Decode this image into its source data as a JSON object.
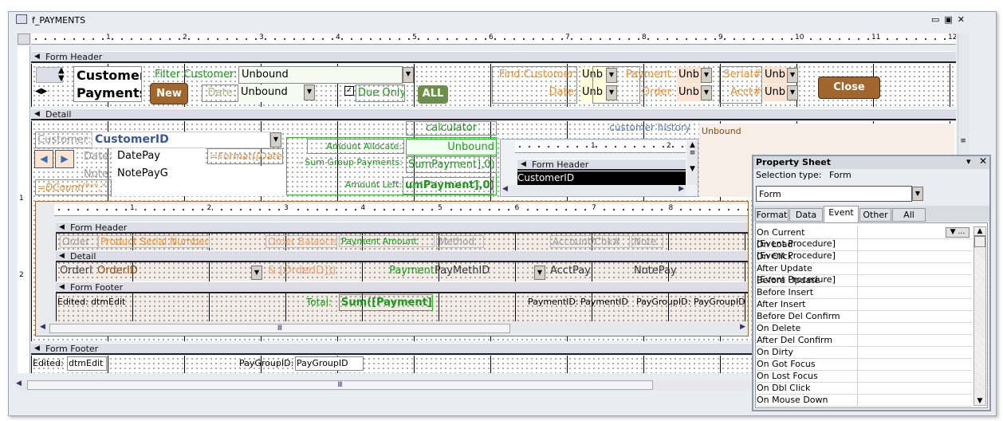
{
  "window": {
    "title": "f_PAYMENTS",
    "controls": [
      "minimize",
      "restore",
      "close"
    ]
  },
  "ruler": [
    "1",
    "2",
    "3",
    "4",
    "5",
    "6",
    "7",
    "8",
    "9",
    "10",
    "11",
    "12"
  ],
  "sections": {
    "form_header": "Form Header",
    "detail": "Detail",
    "form_footer": "Form Footer"
  },
  "header": {
    "title_line1": "Customer",
    "title_line2": "Payments",
    "filter_customer_label": "Filter Customer:",
    "filter_customer_value": "Unbound",
    "new_button": "New",
    "date_label": "Date:",
    "date_value": "Unbound",
    "due_only": "Due Only",
    "due_only_checked": true,
    "all_button": "ALL",
    "find_customer_label": "Find Customer:",
    "find_customer_value": "Unb",
    "date2_label": "Date:",
    "date2_value": "Unb",
    "payment_label": "Payment:",
    "payment_value": "Unb",
    "order_label": "Order:",
    "order_value": "Unb",
    "serial_label": "Serial#",
    "serial_value": "Unb",
    "acct_label": "Acct#",
    "acct_value": "Unb",
    "close_button": "Close"
  },
  "detail": {
    "customer_label": "Customer:",
    "customer_value": "CustomerID",
    "date_label": "Date:",
    "date_value": "DatePay",
    "format_expr": "=Format([Date",
    "note_label": "Note:",
    "note_value": "NotePayG",
    "dcount_expr": "=DCount(\"*\",\"",
    "calculator": "calculator",
    "amount_allocate_label": "Amount Allocate:",
    "amount_allocate_value": "Unbound",
    "sum_group_label": "- Sum Group Payments:",
    "sum_group_value": "SumPayment],0))",
    "amount_left_label": "Amount Left:",
    "amount_left_value": "umPayment],0))",
    "customer_history": "customer history",
    "history_value": "Unbound",
    "mini": {
      "ruler": [
        "1",
        "2"
      ],
      "header": "Form Header",
      "field": "CustomerID"
    }
  },
  "subform": {
    "ruler": [
      "1",
      "2",
      "3",
      "4",
      "5",
      "6",
      "7",
      "8"
    ],
    "header_cols": [
      "Order",
      "Product Serial Number",
      "Order Balance",
      "Payment Amount",
      "Method",
      "Account/Chk#",
      "Note"
    ],
    "detail_cols": [
      "OrderI",
      "OrderID",
      "& [OrderID]))",
      "Payment",
      "PayMethID",
      "AcctPay",
      "NotePay"
    ],
    "footer": {
      "edited_label": "Edited:",
      "edited_value": "dtmEdit",
      "total_label": "Total:",
      "total_value": "Sum([Payment])",
      "pid_label": "PaymentID:",
      "pid_value": "PaymentID",
      "pgid_label": "PayGroupID:",
      "pgid_value": "PayGroupID"
    }
  },
  "footer": {
    "edited_label": "Edited:",
    "edited_value": "dtmEdit",
    "pgid_label": "PayGroupID:",
    "pgid_value": "PayGroupID"
  },
  "property_sheet": {
    "title": "Property Sheet",
    "selection_type_label": "Selection type:",
    "selection_type": "Form",
    "object": "Form",
    "tabs": [
      "Format",
      "Data",
      "Event",
      "Other",
      "All"
    ],
    "active_tab": "Event",
    "rows": [
      {
        "name": "On Current",
        "value": "[Event Procedure]"
      },
      {
        "name": "On Load",
        "value": "[Event Procedure]"
      },
      {
        "name": "On Click",
        "value": ""
      },
      {
        "name": "After Update",
        "value": "[Event Procedure]"
      },
      {
        "name": "Before Update",
        "value": ""
      },
      {
        "name": "Before Insert",
        "value": ""
      },
      {
        "name": "After Insert",
        "value": ""
      },
      {
        "name": "Before Del Confirm",
        "value": ""
      },
      {
        "name": "On Delete",
        "value": ""
      },
      {
        "name": "After Del Confirm",
        "value": ""
      },
      {
        "name": "On Dirty",
        "value": ""
      },
      {
        "name": "On Got Focus",
        "value": ""
      },
      {
        "name": "On Lost Focus",
        "value": ""
      },
      {
        "name": "On Dbl Click",
        "value": ""
      },
      {
        "name": "On Mouse Down",
        "value": ""
      }
    ]
  },
  "colors": {
    "new_button": "#a0662e",
    "close_button": "#a0662e",
    "all_button": "#6e8f4a",
    "label_orange": "#e8903a",
    "label_green": "#1a9a1a"
  }
}
